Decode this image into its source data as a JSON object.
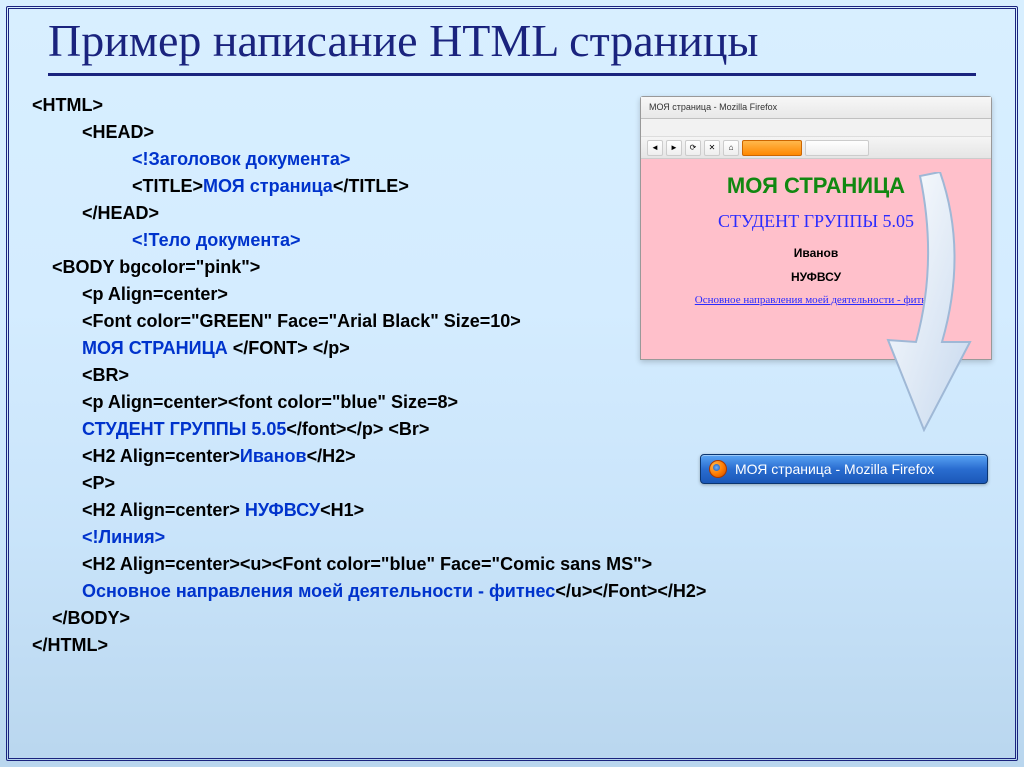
{
  "title": "Пример написание HTML страницы",
  "code": {
    "l1": "<HTML>",
    "l2": "          <HEAD>",
    "l3": "                    <!Заголовок документа>",
    "l4a": "                    <TITLE>",
    "l4b": "МОЯ страница",
    "l4c": "</TITLE>",
    "l5": "          </HEAD>",
    "l6": "                    <!Тело документа>",
    "l7": "    <BODY bgcolor=\"pink\">",
    "l8": "          <p Align=center>",
    "l9": "          <Font color=\"GREEN\" Face=\"Arial Black\" Size=10>",
    "l10a": "          ",
    "l10b": "МОЯ СТРАНИЦА ",
    "l10c": "</FONT> </p>",
    "l11": "          <BR>",
    "l12": "          <p Align=center><font color=\"blue\" Size=8>",
    "l13a": "          ",
    "l13b": "СТУДЕНТ ГРУППЫ 5.05",
    "l13c": "</font></p> <Br>",
    "l14a": "          <H2 Align=center>",
    "l14b": "Иванов",
    "l14c": "</H2>",
    "l15": "          <P>",
    "l16a": "          <H2 Align=center> ",
    "l16b": "НУФВСУ",
    "l16c": "<H1>",
    "l17": "          <!Линия>",
    "l18": "          <H2 Align=center><u><Font color=\"blue\" Face=\"Comic sans MS\">",
    "l19a": "          ",
    "l19b": "Основное направления моей деятельности - фитнес",
    "l19c": "</u></Font></H2>",
    "l20": "    </BODY>",
    "l21": "</HTML>"
  },
  "preview": {
    "tab_title": "МОЯ страница - Mozilla Firefox",
    "page_title": "МОЯ СТРАНИЦА",
    "subtitle": "СТУДЕНТ ГРУППЫ 5.05",
    "name": "Иванов",
    "org": "НУФВСУ",
    "link": "Основное направления моей деятельности - фитнес"
  },
  "taskbar": {
    "label": "МОЯ страница - Mozilla Firefox"
  }
}
